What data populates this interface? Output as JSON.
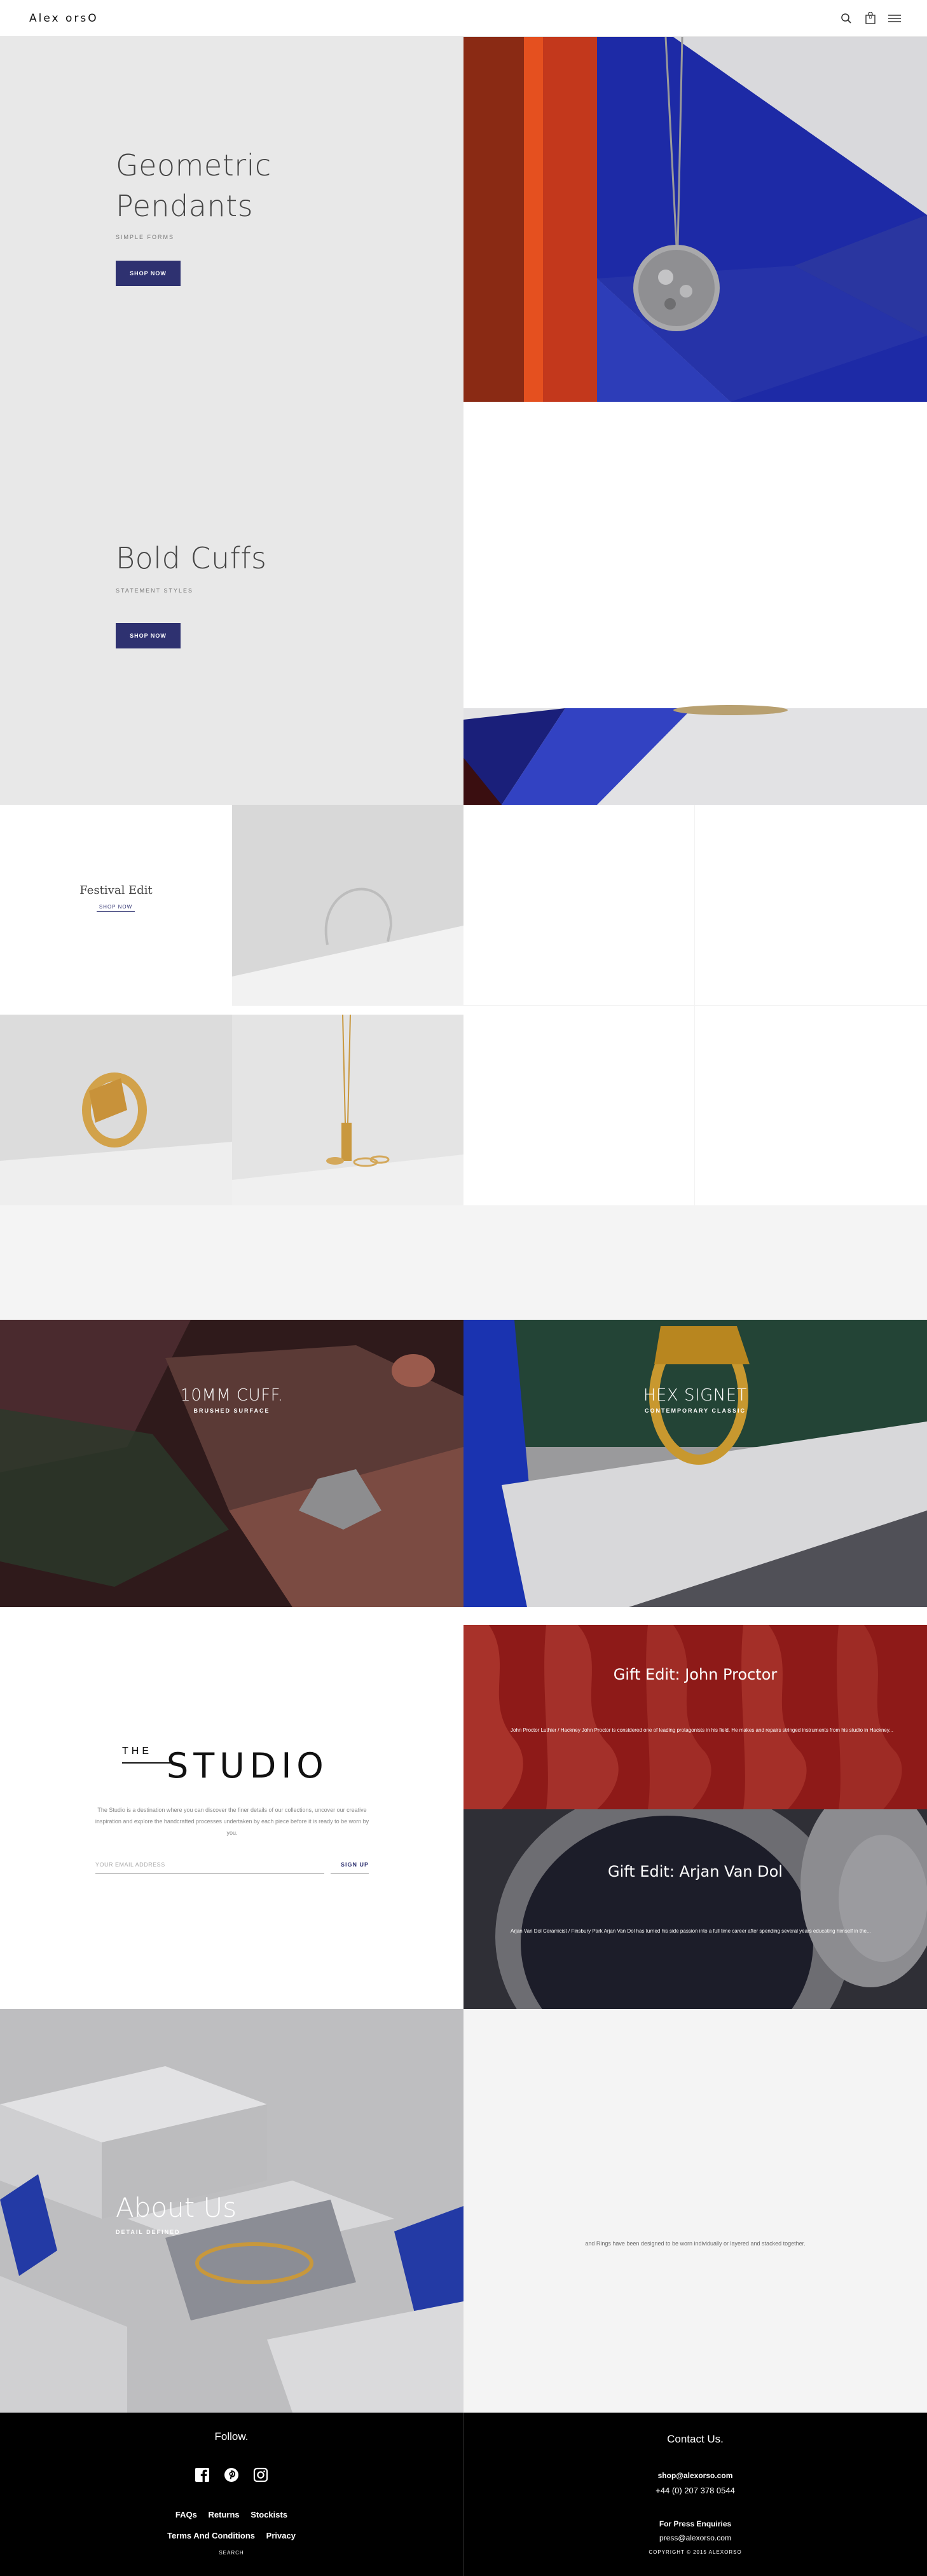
{
  "header": {
    "logo": "Alex    orsO",
    "icons": [
      "search-icon",
      "cart-icon",
      "menu-icon"
    ],
    "cart_count": "0"
  },
  "hero1": {
    "title_line1": "Geometric",
    "title_line2": "Pendants",
    "subtitle": "SIMPLE FORMS",
    "button": "SHOP NOW"
  },
  "hero2": {
    "title": "Bold Cuffs",
    "subtitle": "STATEMENT STYLES",
    "button": "SHOP NOW"
  },
  "festival": {
    "title": "Festival Edit",
    "link": "SHOP NOW"
  },
  "features": [
    {
      "title": "10MM CUFF.",
      "subtitle": "BRUSHED SURFACE"
    },
    {
      "title": "HEX SIGNET",
      "subtitle": "CONTEMPORARY CLASSIC"
    }
  ],
  "studio": {
    "the": "THE",
    "title": "STUDIO",
    "body": "The Studio is a destination where you can discover the finer details of our collections, uncover our creative inspiration and explore the handcrafted processes undertaken by each piece before it is ready to be worn by you.",
    "email_placeholder": "YOUR EMAIL ADDRESS",
    "signup": "SIGN UP"
  },
  "gift_edits": [
    {
      "title": "Gift Edit: John Proctor",
      "body": "John Proctor Luthier / Hackney   John Proctor is considered one of leading protagonists in his field. He makes and repairs stringed instruments from his studio in Hackney..."
    },
    {
      "title": "Gift Edit: Arjan Van Dol",
      "body": "Arjan Van Dol Ceramicist / Finsbury Park   Arjan Van Dol has turned his side passion into a full time career after spending several years educating himself in the..."
    }
  ],
  "about": {
    "title": "About Us",
    "subtitle": "DETAIL DEFINED",
    "side_text": "and Rings have been designed to be worn individually or layered and stacked together."
  },
  "footer": {
    "follow": "Follow.",
    "social_icons": [
      "facebook-icon",
      "pinterest-icon",
      "instagram-icon"
    ],
    "links_row1": [
      "FAQs",
      "Returns",
      "Stockists"
    ],
    "links_row2": [
      "Terms And Conditions",
      "Privacy"
    ],
    "search": "SEARCH",
    "contact_title": "Contact Us.",
    "email": "shop@alexorso.com",
    "phone": "+44 (0) 207 378 0544",
    "press_label": "For Press Enquiries",
    "press_email": "press@alexorso.com",
    "copyright": "COPYRIGHT © 2015 ALEXORSO"
  },
  "colors": {
    "accent": "#2e3170",
    "hero_bg": "#e8e8e8",
    "footer_bg": "#000000",
    "gift1_tint": "#8a1414"
  }
}
